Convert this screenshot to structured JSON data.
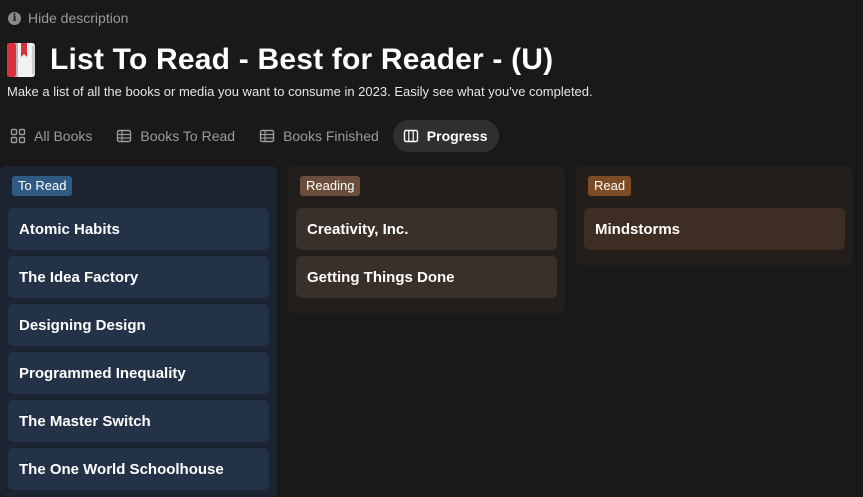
{
  "header": {
    "hide_description": "Hide description",
    "title": "List To Read - Best for Reader - (U)",
    "description": "Make a list of all the books or media you want to consume in 2023. Easily see what you've completed."
  },
  "tabs": [
    {
      "label": "All Books",
      "icon": "gallery-grid-icon",
      "active": false
    },
    {
      "label": "Books To Read",
      "icon": "table-icon",
      "active": false
    },
    {
      "label": "Books Finished",
      "icon": "table-icon",
      "active": false
    },
    {
      "label": "Progress",
      "icon": "board-icon",
      "active": true
    }
  ],
  "columns": [
    {
      "label": "To Read",
      "color": "#2e5a83",
      "cards": [
        "Atomic Habits",
        "The Idea Factory",
        "Designing Design",
        "Programmed Inequality",
        "The Master Switch",
        "The One World Schoolhouse"
      ]
    },
    {
      "label": "Reading",
      "color": "#6a4d3a",
      "cards": [
        "Creativity, Inc.",
        "Getting Things Done"
      ]
    },
    {
      "label": "Read",
      "color": "#7d4c25",
      "cards": [
        "Mindstorms"
      ]
    }
  ]
}
